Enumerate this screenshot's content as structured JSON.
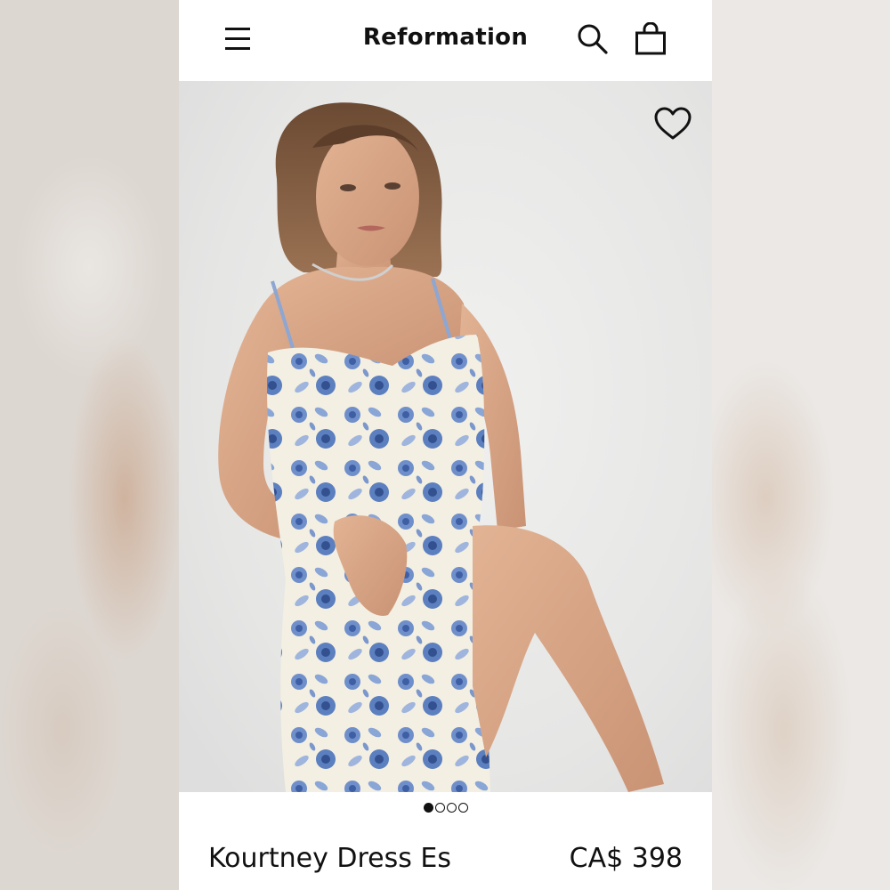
{
  "header": {
    "brand": "Reformation",
    "icons": [
      "menu-icon",
      "search-icon",
      "bag-icon"
    ]
  },
  "gallery": {
    "favorite_icon": "heart-icon",
    "total_images": 4,
    "active_index": 0
  },
  "product": {
    "name": "Kourtney Dress Es",
    "price": "CA$ 398"
  },
  "colors": {
    "text": "#111111",
    "background": "#ffffff",
    "print_blue": "#5b7fbf",
    "print_cream": "#f3efe3"
  }
}
